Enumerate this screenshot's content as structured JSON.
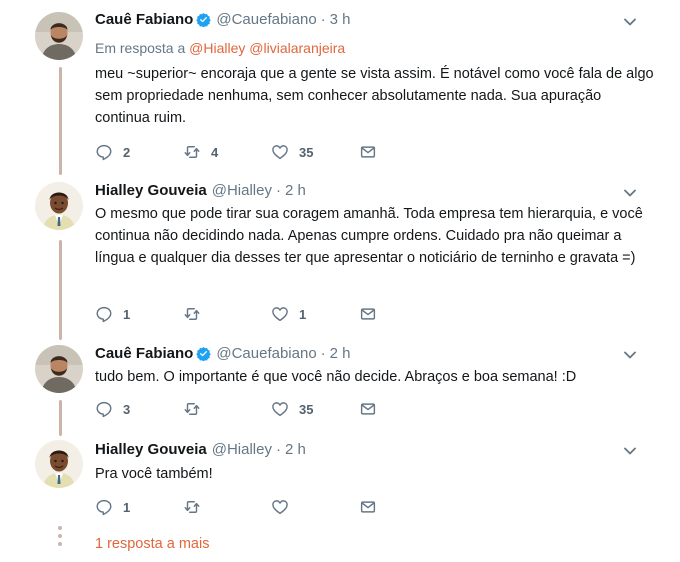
{
  "colors": {
    "accent": "#e0663c",
    "muted": "#657786",
    "thread_line": "#cdb4a8"
  },
  "tweets": [
    {
      "name": "Cauê Fabiano",
      "verified": true,
      "handle": "@Cauefabiano",
      "time": "3 h",
      "reply_prefix": "Em resposta a",
      "reply_mentions": "@Hialley @livialaranjeira",
      "text": "meu ~superior~ encoraja que a gente se vista assim. É notável como você fala de algo sem propriedade nenhuma, sem conhecer absolutamente nada. Sua apuração continua ruim.",
      "replies": "2",
      "retweets": "4",
      "likes": "35",
      "avatar_icon": "bearded-man-avatar"
    },
    {
      "name": "Hialley Gouveia",
      "verified": false,
      "handle": "@Hialley",
      "time": "2 h",
      "text": "O mesmo que pode tirar sua coragem amanhã. Toda empresa tem hierarquia, e você continua não decidindo nada. Apenas cumpre ordens. Cuidado pra não queimar a língua e qualquer dia desses ter que apresentar o noticiário de terninho e gravata =)",
      "replies": "1",
      "retweets": "",
      "likes": "1",
      "avatar_icon": "child-in-suit-avatar"
    },
    {
      "name": "Cauê Fabiano",
      "verified": true,
      "handle": "@Cauefabiano",
      "time": "2 h",
      "text": "tudo bem. O importante é que você não decide. Abraços e boa semana! :D",
      "replies": "3",
      "retweets": "",
      "likes": "35",
      "avatar_icon": "bearded-man-avatar"
    },
    {
      "name": "Hialley Gouveia",
      "verified": false,
      "handle": "@Hialley",
      "time": "2 h",
      "text": "Pra você também!",
      "replies": "1",
      "retweets": "",
      "likes": "",
      "avatar_icon": "child-in-suit-avatar"
    }
  ],
  "more_replies": "1 resposta a mais"
}
